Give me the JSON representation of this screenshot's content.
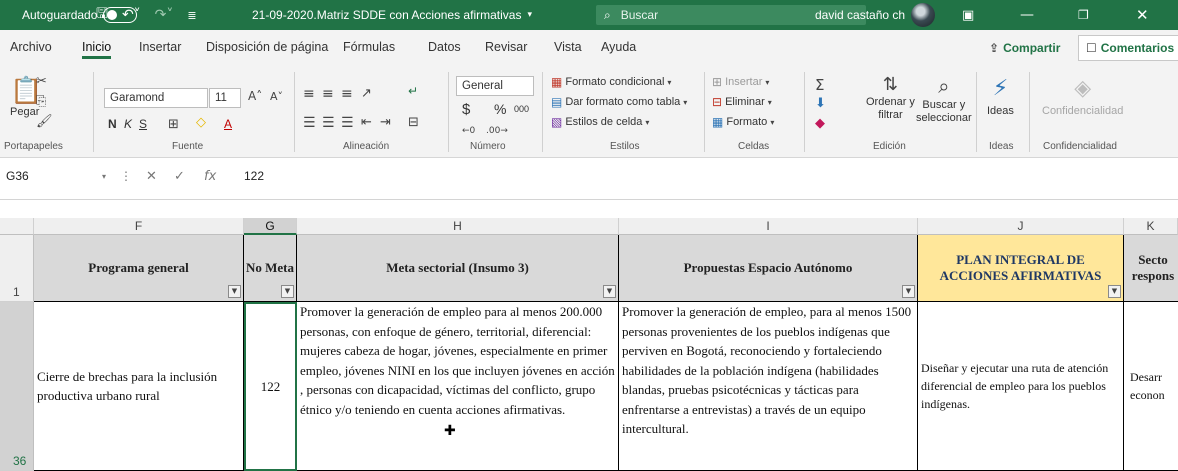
{
  "titlebar": {
    "autosave_label": "Autoguardado",
    "doc_title": "21-09-2020.Matriz SDDE con Acciones afirmativas",
    "search_placeholder": "Buscar",
    "user_name": "david castaño ch"
  },
  "menu": {
    "tabs": [
      "Archivo",
      "Inicio",
      "Insertar",
      "Disposición de página",
      "Fórmulas",
      "Datos",
      "Revisar",
      "Vista",
      "Ayuda"
    ],
    "active_tab": "Inicio",
    "share_label": "Compartir",
    "comments_label": "Comentarios"
  },
  "ribbon": {
    "paste_label": "Pegar",
    "font_name": "Garamond",
    "font_size": "11",
    "number_format": "General",
    "conditional_format": "Formato condicional",
    "format_as_table": "Dar formato como tabla",
    "cell_styles": "Estilos de celda",
    "insert": "Insertar",
    "delete": "Eliminar",
    "format": "Formato",
    "sort_filter_1": "Ordenar y",
    "sort_filter_2": "filtrar",
    "find_select_1": "Buscar y",
    "find_select_2": "seleccionar",
    "ideas": "Ideas",
    "sensitivity": "Confidencialidad",
    "groups": [
      "Portapapeles",
      "Fuente",
      "Alineación",
      "Número",
      "Estilos",
      "Celdas",
      "Edición",
      "Ideas",
      "Confidencialidad"
    ]
  },
  "formula_bar": {
    "cell_ref": "G36",
    "value": "122"
  },
  "sheet": {
    "columns": [
      "F",
      "G",
      "H",
      "I",
      "J",
      "K"
    ],
    "selected_column": "G",
    "header_row_num": "1",
    "data_row_num": "36",
    "headers": {
      "F": "Programa general",
      "G": "No Meta",
      "H": "Meta sectorial (Insumo 3)",
      "I": "Propuestas Espacio Autónomo",
      "J": "PLAN INTEGRAL DE ACCIONES AFIRMATIVAS",
      "K": "Secto respons"
    },
    "row36": {
      "F": "Cierre de brechas para la inclusión productiva urbano rural",
      "G": "122",
      "H": "Promover la generación de empleo para al menos 200.000 personas, con enfoque de género, territorial, diferencial: mujeres cabeza de hogar, jóvenes, especialmente en primer empleo, jóvenes NINI en los que incluyen jóvenes en acción , personas con dicapacidad, víctimas del conflicto, grupo étnico y/o teniendo en cuenta acciones afirmativas.",
      "I": "Promover la generación de empleo, para al menos 1500 personas provenientes de los pueblos indígenas que perviven en Bogotá, reconociendo y fortaleciendo habilidades de la población indígena (habilidades blandas, pruebas psicotécnicas y tácticas para enfrentarse a entrevistas) a través de un equipo intercultural.",
      "J": "Diseñar y ejecutar  una ruta de atención diferencial de empleo para los pueblos  indígenas.",
      "K": "Desarr econon"
    }
  },
  "colors": {
    "excel_green": "#217346",
    "header_gray": "#d9d9d9",
    "plan_header_gold": "#ffe79a"
  }
}
